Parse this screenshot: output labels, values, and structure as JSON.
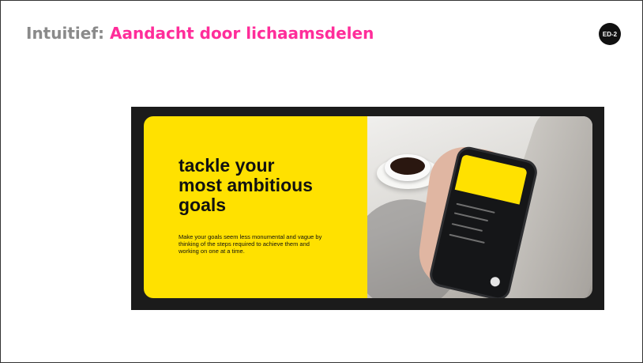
{
  "slide": {
    "title_prefix": "Intuitief: ",
    "title_main": "Aandacht door lichaamsdelen",
    "badge": "ED-2"
  },
  "ad": {
    "headline_lines": [
      "tackle your",
      "most ambitious",
      "goals"
    ],
    "body": "Make your goals seem less monumental and vague by thinking of the steps required to achieve them and working on one at a time."
  },
  "colors": {
    "title_gray": "#8a8a8a",
    "title_pink": "#ff2d9a",
    "ad_yellow": "#ffe100",
    "badge_bg": "#111111"
  }
}
